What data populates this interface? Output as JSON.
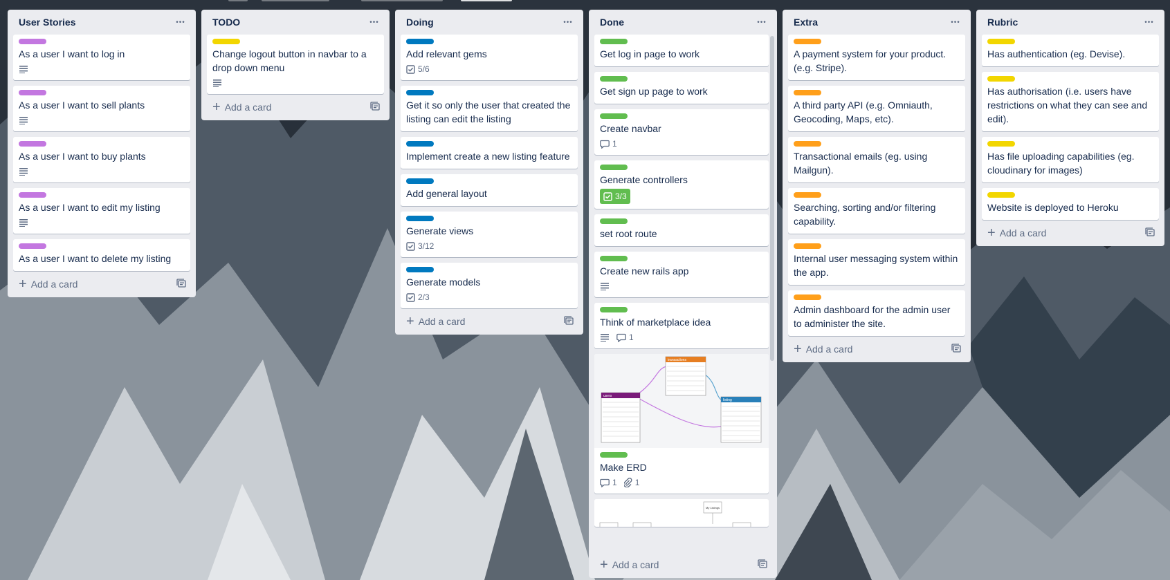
{
  "colors": {
    "purple": "#c377e0",
    "yellow": "#f2d600",
    "blue": "#0079bf",
    "green": "#61bd4f",
    "orange": "#ff9f1a"
  },
  "add_card_label": "Add a card",
  "lists": [
    {
      "title": "User Stories",
      "cards": [
        {
          "label": "purple",
          "title": "As a user I want to log in",
          "desc": true
        },
        {
          "label": "purple",
          "title": "As a user I want to sell plants",
          "desc": true
        },
        {
          "label": "purple",
          "title": "As a user I want to buy plants",
          "desc": true
        },
        {
          "label": "purple",
          "title": "As a user I want to edit my listing",
          "desc": true
        },
        {
          "label": "purple",
          "title": "As a user I want to delete my listing",
          "desc": false
        }
      ]
    },
    {
      "title": "TODO",
      "cards": [
        {
          "label": "yellow",
          "title": "Change logout button in navbar to a drop down menu",
          "desc": true
        }
      ]
    },
    {
      "title": "Doing",
      "cards": [
        {
          "label": "blue",
          "title": "Add relevant gems",
          "checklist": "5/6"
        },
        {
          "label": "blue",
          "title": "Get it so only the user that created the listing can edit the listing"
        },
        {
          "label": "blue",
          "title": "Implement create a new listing feature"
        },
        {
          "label": "blue",
          "title": "Add general layout"
        },
        {
          "label": "blue",
          "title": "Generate views",
          "checklist": "3/12"
        },
        {
          "label": "blue",
          "title": "Generate models",
          "checklist": "2/3"
        }
      ]
    },
    {
      "title": "Done",
      "cards": [
        {
          "label": "green",
          "title": "Get log in page to work"
        },
        {
          "label": "green",
          "title": "Get sign up page to work"
        },
        {
          "label": "green",
          "title": "Create navbar",
          "comments": "1"
        },
        {
          "label": "green",
          "title": "Generate controllers",
          "checklist": "3/3",
          "checklist_complete": true
        },
        {
          "label": "green",
          "title": "set root route"
        },
        {
          "label": "green",
          "title": "Create new rails app",
          "desc": true
        },
        {
          "label": "green",
          "title": "Think of marketplace idea",
          "desc": true,
          "comments": "1"
        },
        {
          "label": "green",
          "title": "Make ERD",
          "cover": "erd",
          "comments": "1",
          "attachments": "1"
        },
        {
          "cover": "flow"
        }
      ]
    },
    {
      "title": "Extra",
      "cards": [
        {
          "label": "orange",
          "title": "A payment system for your product. (e.g. Stripe)."
        },
        {
          "label": "orange",
          "title": "A third party API (e.g. Omniauth, Geocoding, Maps, etc)."
        },
        {
          "label": "orange",
          "title": "Transactional emails (eg. using Mailgun)."
        },
        {
          "label": "orange",
          "title": "Searching, sorting and/or filtering capability."
        },
        {
          "label": "orange",
          "title": "Internal user messaging system within the app."
        },
        {
          "label": "orange",
          "title": "Admin dashboard for the admin user to administer the site."
        }
      ]
    },
    {
      "title": "Rubric",
      "cards": [
        {
          "label": "yellow",
          "title": "Has authentication (eg. Devise)."
        },
        {
          "label": "yellow",
          "title": "Has authorisation (i.e. users have restrictions on what they can see and edit)."
        },
        {
          "label": "yellow",
          "title": "Has file uploading capabilities (eg. cloudinary for images)"
        },
        {
          "label": "yellow",
          "title": "Website is deployed to Heroku"
        }
      ]
    }
  ],
  "erd_labels": {
    "users": "users",
    "transactions": "transactions",
    "listing": "listing"
  },
  "flow_label": "My Listings"
}
